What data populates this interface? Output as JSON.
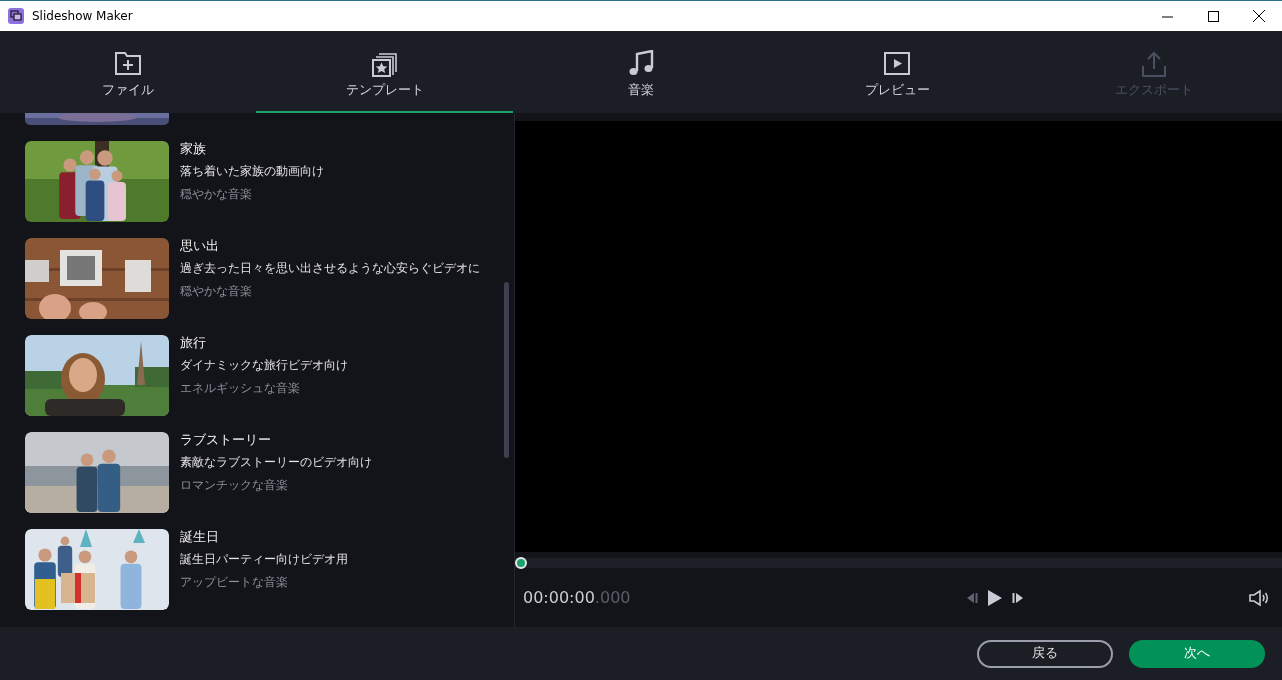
{
  "window": {
    "title": "Slideshow Maker"
  },
  "tabs": [
    {
      "label": "ファイル",
      "selected": false,
      "disabled": false
    },
    {
      "label": "テンプレート",
      "selected": true,
      "disabled": false
    },
    {
      "label": "音楽",
      "selected": false,
      "disabled": false
    },
    {
      "label": "プレビュー",
      "selected": false,
      "disabled": false
    },
    {
      "label": "エクスポート",
      "selected": false,
      "disabled": true
    }
  ],
  "templates": [
    {
      "title": "家族",
      "description": "落ち着いた家族の動画向け",
      "music": "穏やかな音楽"
    },
    {
      "title": "思い出",
      "description": "過ぎ去った日々を思い出させるような心安らぐビデオに",
      "music": "穏やかな音楽"
    },
    {
      "title": "旅行",
      "description": "ダイナミックな旅行ビデオ向け",
      "music": "エネルギッシュな音楽"
    },
    {
      "title": "ラブストーリー",
      "description": "素敵なラブストーリーのビデオ向け",
      "music": "ロマンチックな音楽"
    },
    {
      "title": "誕生日",
      "description": "誕生日パーティー向けビデオ用",
      "music": "アップビートな音楽"
    }
  ],
  "player": {
    "time": "00:00:00",
    "time_fraction": ".000",
    "level": 0
  },
  "buttons": [
    {
      "label": "戻る",
      "kind": "outline"
    },
    {
      "label": "次へ",
      "kind": "primary"
    }
  ]
}
